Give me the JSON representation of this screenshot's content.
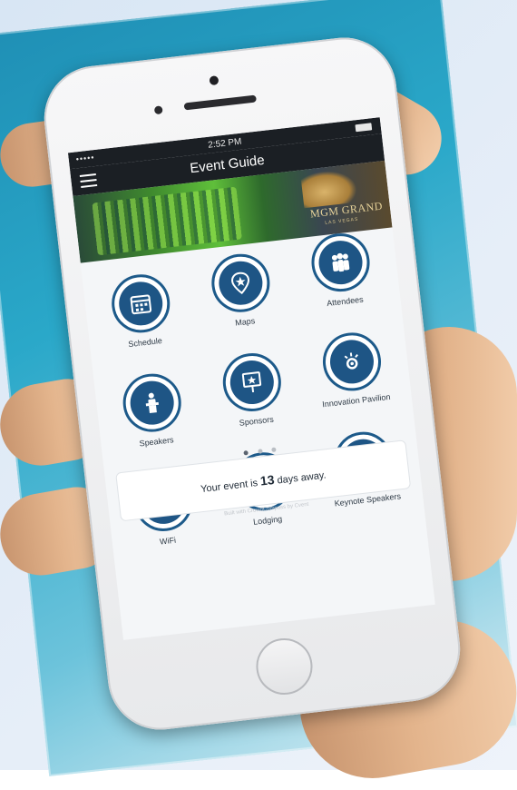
{
  "status_bar": {
    "signal": "•••••",
    "time": "2:52 PM"
  },
  "nav": {
    "title": "Event Guide"
  },
  "banner": {
    "brand": "MGM GRAND",
    "brand_sub": "LAS VEGAS"
  },
  "tiles": [
    {
      "label": "Schedule",
      "icon": "calendar-icon"
    },
    {
      "label": "Maps",
      "icon": "map-pin-icon"
    },
    {
      "label": "Attendees",
      "icon": "people-icon"
    },
    {
      "label": "Speakers",
      "icon": "podium-icon"
    },
    {
      "label": "Sponsors",
      "icon": "sign-star-icon"
    },
    {
      "label": "Innovation Pavilion",
      "icon": "lightbulb-icon"
    },
    {
      "label": "WiFi",
      "icon": "wifi-icon"
    },
    {
      "label": "Lodging",
      "icon": "bed-icon"
    },
    {
      "label": "Keynote Speakers",
      "icon": "microphone-star-icon"
    }
  ],
  "pager": {
    "pages": 3,
    "current": 1
  },
  "countdown": {
    "prefix": "Your event is",
    "days": "13",
    "suffix": "days away."
  },
  "footer": {
    "text": "Built with CrowdCompass by Cvent"
  },
  "colors": {
    "accent": "#1e5585",
    "nav_bg": "#1b1f24",
    "screen_bg": "#f4f6f8"
  }
}
